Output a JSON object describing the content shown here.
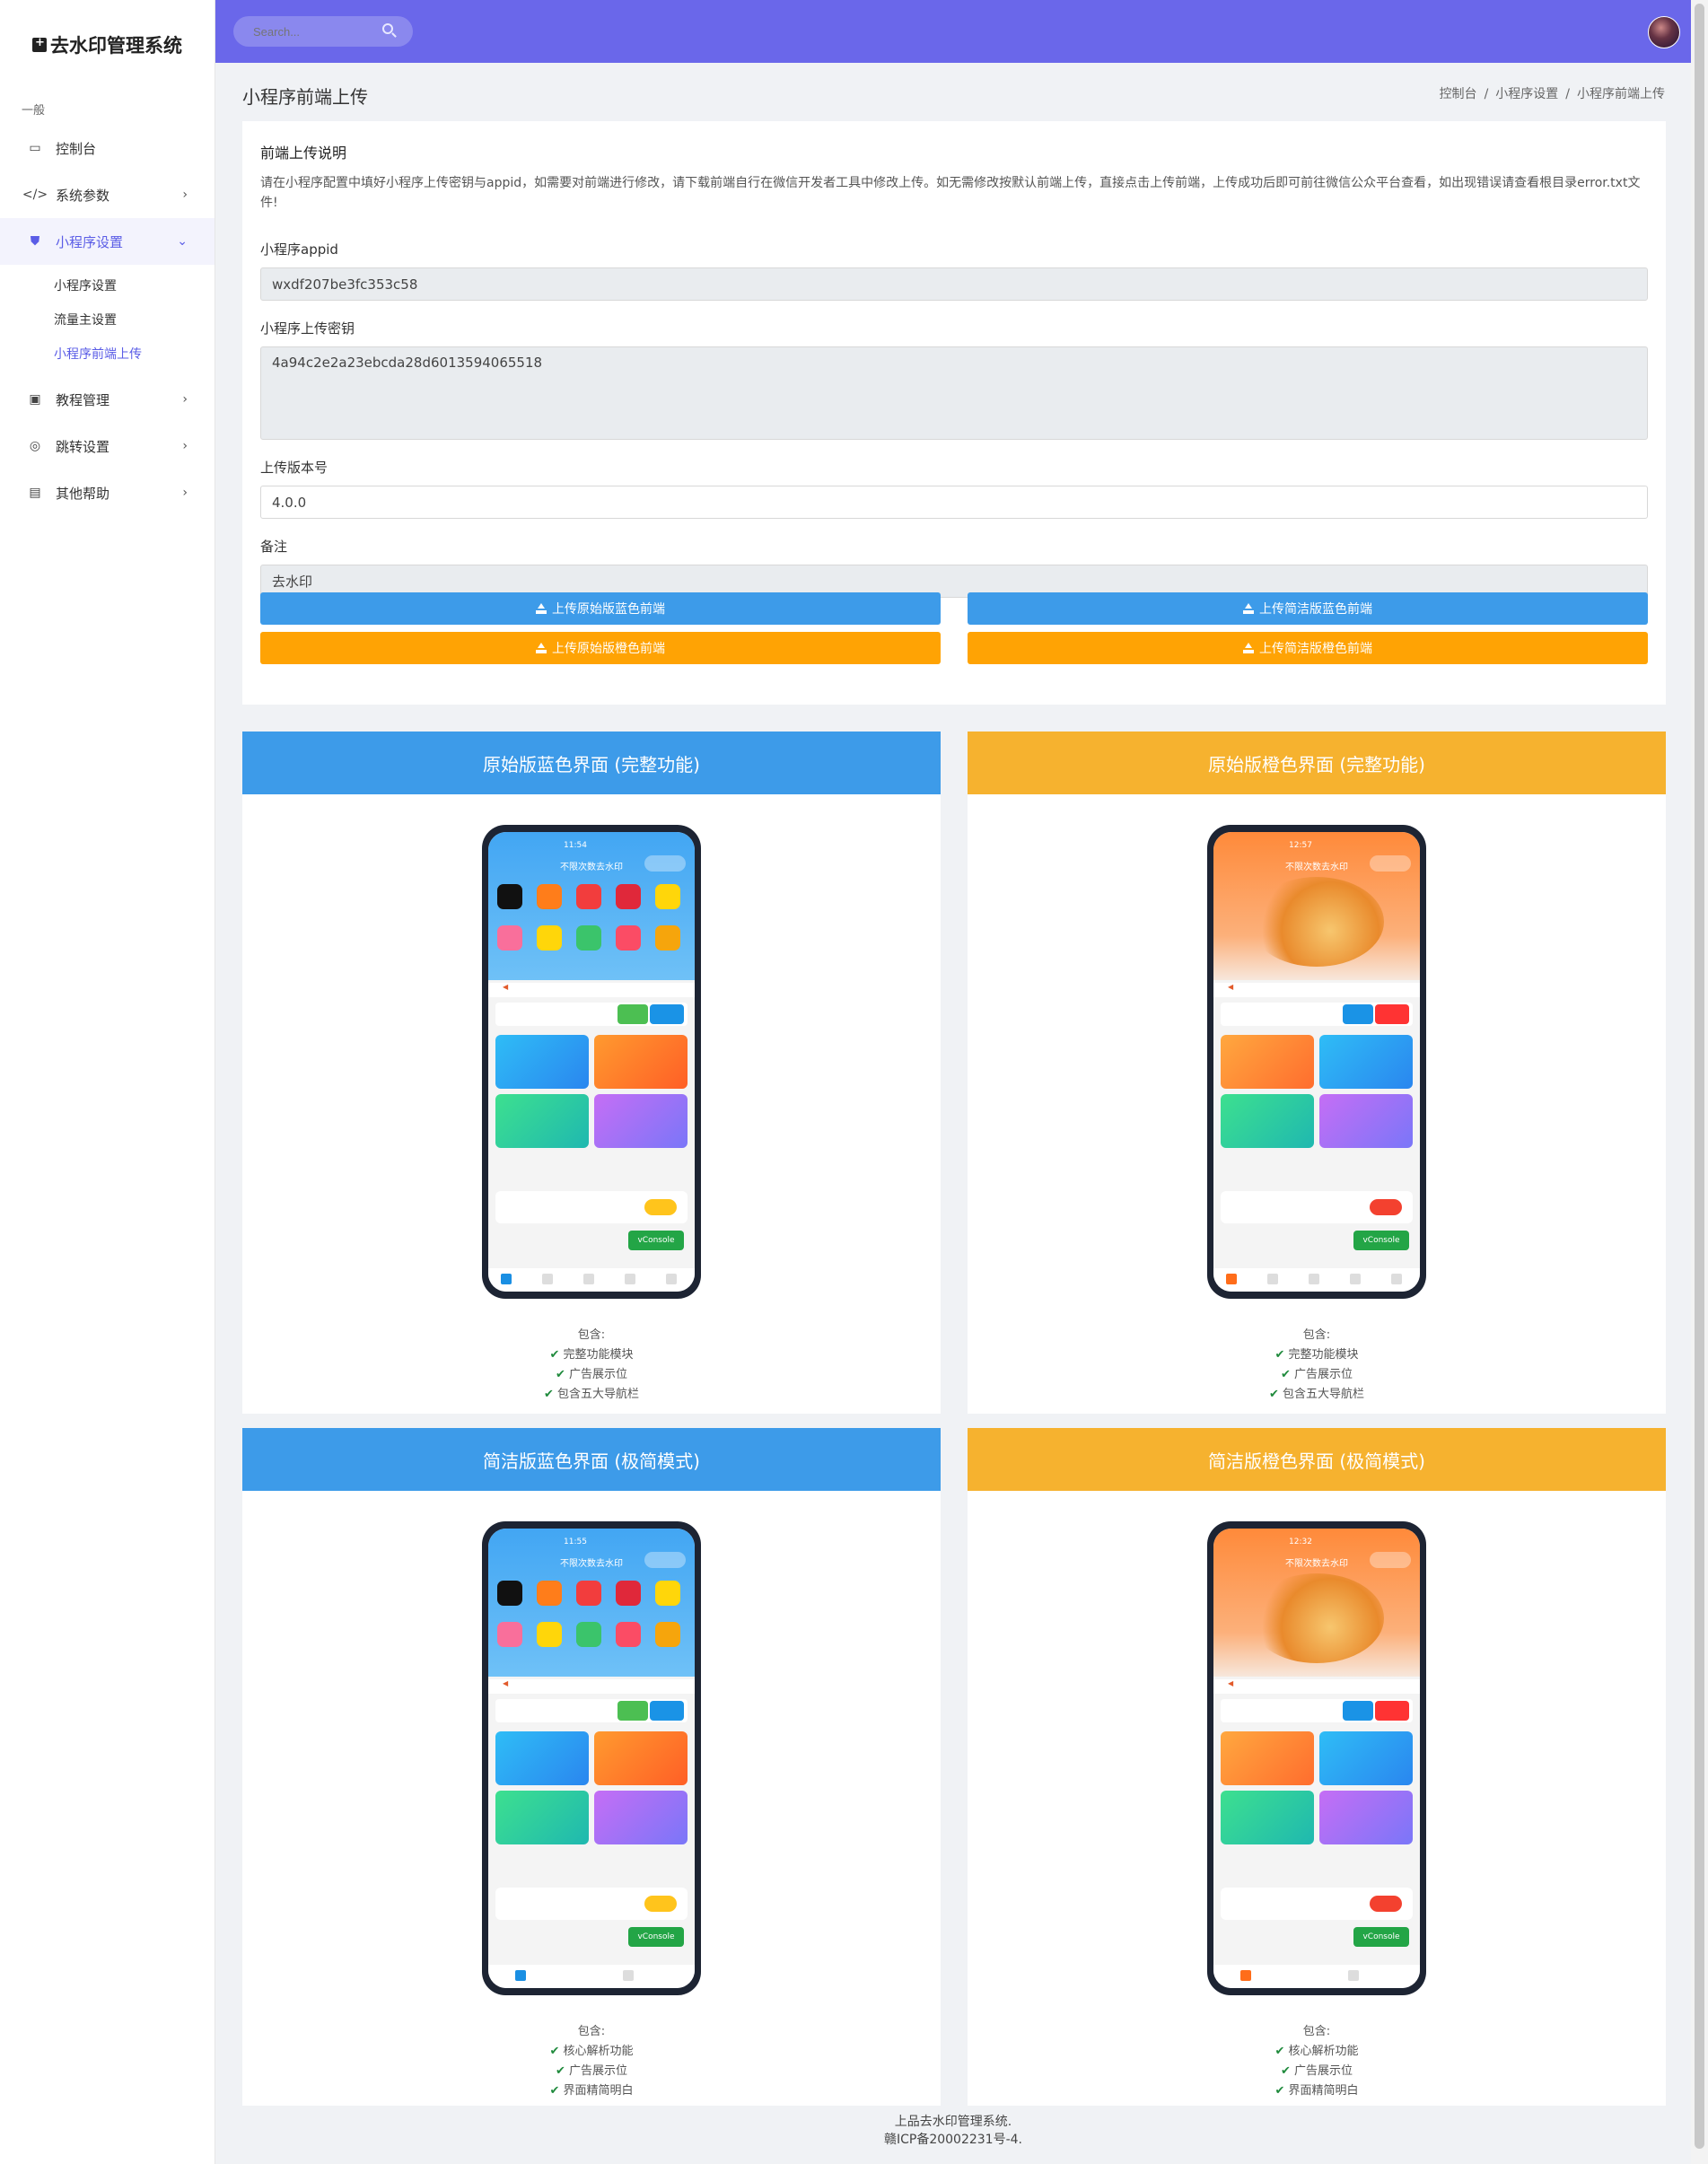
{
  "app": {
    "title": "去水印管理系统"
  },
  "sidebar": {
    "group": "一般",
    "items": [
      {
        "label": "控制台",
        "icon": "monitor-icon"
      },
      {
        "label": "系统参数",
        "icon": "code-icon"
      },
      {
        "label": "小程序设置",
        "icon": "shield-icon"
      },
      {
        "label": "教程管理",
        "icon": "book-icon"
      },
      {
        "label": "跳转设置",
        "icon": "fingerprint-icon"
      },
      {
        "label": "其他帮助",
        "icon": "file-icon"
      }
    ],
    "submenu": [
      {
        "label": "小程序设置"
      },
      {
        "label": "流量主设置"
      },
      {
        "label": "小程序前端上传"
      }
    ]
  },
  "topbar": {
    "search_placeholder": "Search..."
  },
  "page": {
    "title": "小程序前端上传",
    "breadcrumb": [
      "控制台",
      "小程序设置",
      "小程序前端上传"
    ]
  },
  "form": {
    "section_title": "前端上传说明",
    "description": "请在小程序配置中填好小程序上传密钥与appid，如需要对前端进行修改，请下载前端自行在微信开发者工具中修改上传。如无需修改按默认前端上传，直接点击上传前端，上传成功后即可前往微信公众平台查看，如出现错误请查看根目录error.txt文件!",
    "appid_label": "小程序appid",
    "appid_value": "wxdf207be3fc353c58",
    "secret_label": "小程序上传密钥",
    "secret_value": "4a94c2e2a23ebcda28d6013594065518",
    "version_label": "上传版本号",
    "version_value": "4.0.0",
    "remark_label": "备注",
    "remark_value": "去水印",
    "buttons": [
      {
        "label": "上传原始版蓝色前端",
        "color": "#3d9be9"
      },
      {
        "label": "上传简洁版蓝色前端",
        "color": "#3d9be9"
      },
      {
        "label": "上传原始版橙色前端",
        "color": "#ffa304"
      },
      {
        "label": "上传简洁版橙色前端",
        "color": "#ffa304"
      }
    ]
  },
  "previews": [
    {
      "title": "原始版蓝色界面 (完整功能)",
      "theme": "blue",
      "time": "11:54",
      "screen_title": "不限次数去水印",
      "includes_label": "包含:",
      "includes": [
        "完整功能模块",
        "广告展示位",
        "包含五大导航栏"
      ]
    },
    {
      "title": "原始版橙色界面 (完整功能)",
      "theme": "orange",
      "time": "12:57",
      "screen_title": "不限次数去水印",
      "includes_label": "包含:",
      "includes": [
        "完整功能模块",
        "广告展示位",
        "包含五大导航栏"
      ]
    },
    {
      "title": "简洁版蓝色界面 (极简模式)",
      "theme": "blue",
      "time": "11:55",
      "screen_title": "不限次数去水印",
      "includes_label": "包含:",
      "includes": [
        "核心解析功能",
        "广告展示位",
        "界面精简明白"
      ]
    },
    {
      "title": "简洁版橙色界面 (极简模式)",
      "theme": "orange",
      "time": "12:32",
      "screen_title": "不限次数去水印",
      "includes_label": "包含:",
      "includes": [
        "核心解析功能",
        "广告展示位",
        "界面精简明白"
      ]
    }
  ],
  "phone": {
    "vconsole": "vConsole"
  },
  "footer": {
    "line1": "上品去水印管理系统.",
    "line2": "赣ICP备20002231号-4."
  }
}
